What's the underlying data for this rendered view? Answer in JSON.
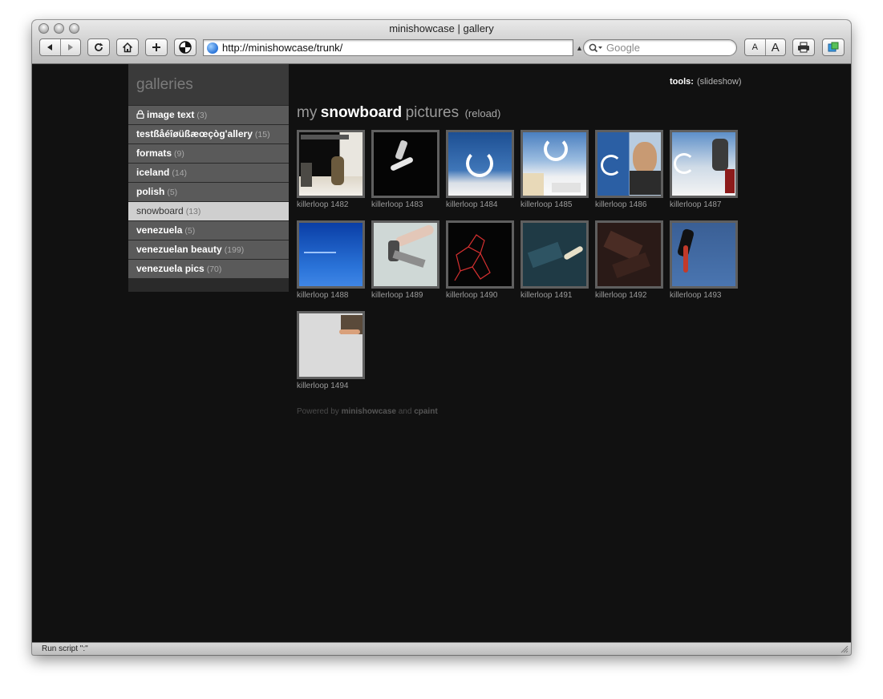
{
  "window": {
    "title": "minishowcase | gallery"
  },
  "toolbar": {
    "url": "http://minishowcase/trunk/",
    "search_placeholder": "Google",
    "font_small": "A",
    "font_large": "A"
  },
  "sidebar": {
    "title": "galleries",
    "items": [
      {
        "label": "image text",
        "count": "(3)",
        "locked": true
      },
      {
        "label": "testßåéîøüßæœçòg'allery",
        "count": "(15)"
      },
      {
        "label": "formats",
        "count": "(9)"
      },
      {
        "label": "iceland",
        "count": "(14)"
      },
      {
        "label": "polish",
        "count": "(5)"
      },
      {
        "label": "snowboard",
        "count": "(13)",
        "active": true
      },
      {
        "label": "venezuela",
        "count": "(5)"
      },
      {
        "label": "venezuelan beauty",
        "count": "(199)"
      },
      {
        "label": "venezuela pics",
        "count": "(70)"
      }
    ]
  },
  "tools": {
    "label": "tools:",
    "slideshow": "(slideshow)"
  },
  "gallery": {
    "heading_my": "my",
    "heading_name": "snowboard",
    "heading_pictures": "pictures",
    "reload": "(reload)",
    "thumbnails": [
      {
        "caption": "killerloop 1482"
      },
      {
        "caption": "killerloop 1483"
      },
      {
        "caption": "killerloop 1484"
      },
      {
        "caption": "killerloop 1485"
      },
      {
        "caption": "killerloop 1486"
      },
      {
        "caption": "killerloop 1487"
      },
      {
        "caption": "killerloop 1488"
      },
      {
        "caption": "killerloop 1489"
      },
      {
        "caption": "killerloop 1490"
      },
      {
        "caption": "killerloop 1491"
      },
      {
        "caption": "killerloop 1492"
      },
      {
        "caption": "killerloop 1493"
      },
      {
        "caption": "killerloop 1494"
      }
    ]
  },
  "footer": {
    "powered_prefix": "Powered by",
    "powered_app": "minishowcase",
    "powered_and": "and",
    "powered_other": "cpaint"
  },
  "statusbar": {
    "text": "Run script \":\""
  }
}
